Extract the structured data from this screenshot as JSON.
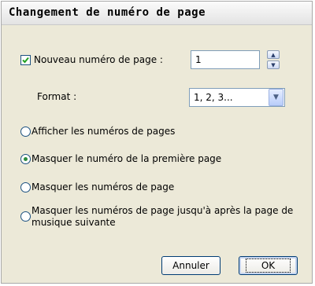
{
  "dialog": {
    "title": "Changement de numéro de page",
    "new_page_number": {
      "label": "Nouveau numéro de page :",
      "checked": true,
      "value": "1"
    },
    "format": {
      "label": "Format :",
      "selected": "1, 2, 3..."
    },
    "options": [
      {
        "label": "Afficher les numéros de pages",
        "selected": false
      },
      {
        "label": "Masquer le numéro de la première page",
        "selected": true
      },
      {
        "label": "Masquer les numéros de page",
        "selected": false
      },
      {
        "label_line1": "Masquer les numéros de page jusqu'à après la page de",
        "label_line2": "musique suivante",
        "selected": false
      }
    ],
    "buttons": {
      "cancel": "Annuler",
      "ok": "OK"
    }
  },
  "icons": {
    "check": "checkmark-icon",
    "spin_up": "arrow-up-icon",
    "spin_down": "arrow-down-icon",
    "dropdown": "chevron-down-icon"
  },
  "colors": {
    "dialog_bg": "#ece9d8",
    "border": "#7f9db9",
    "radio_dot": "#2b8c3d",
    "button_border": "#003c74"
  }
}
